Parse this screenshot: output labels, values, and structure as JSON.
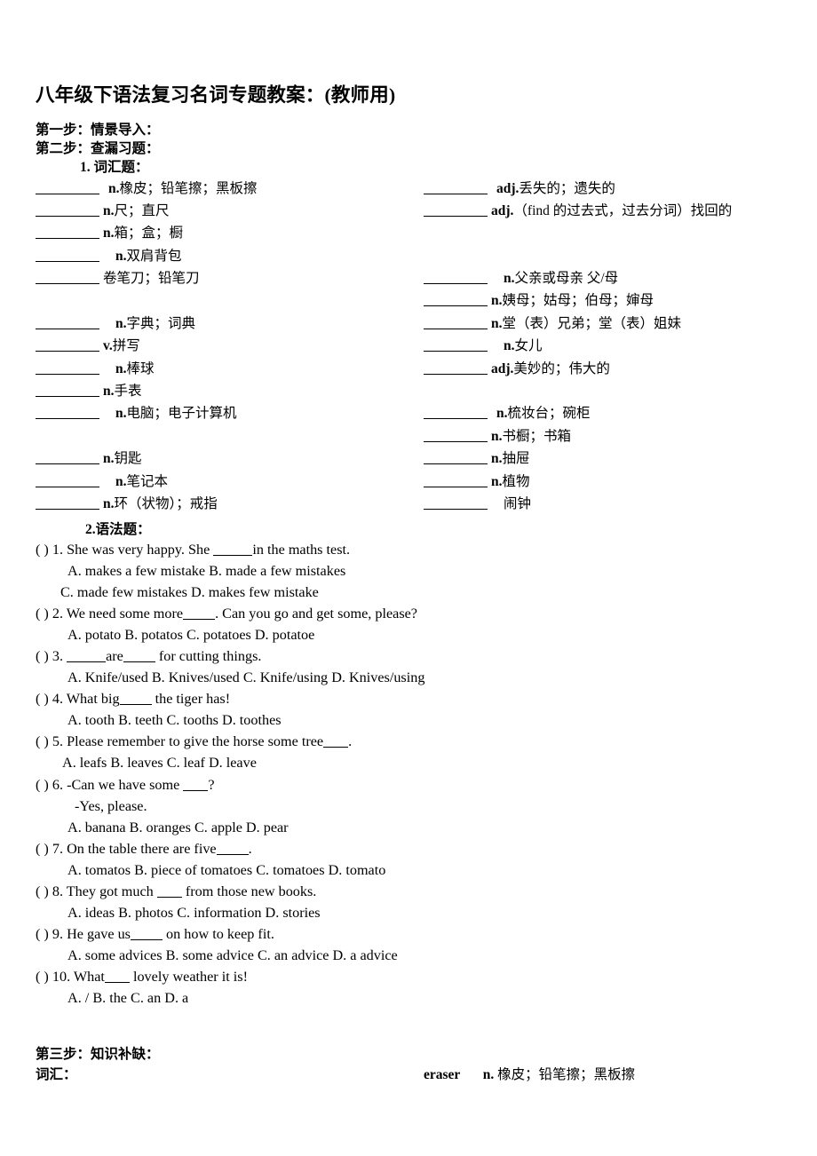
{
  "title": "八年级下语法复习名词专题教案：(教师用)",
  "steps": {
    "step1": "第一步：情景导入：",
    "step2": "第二步：查漏习题：",
    "step3": "第三步：知识补缺："
  },
  "sections": {
    "vocab_head": "1. 词汇题：",
    "grammar_head": "2.语法题：",
    "vocab_label": "词汇："
  },
  "vocab_left": [
    {
      "blank": "bl-7",
      "indent": "gap-m",
      "pos": "n.",
      "meaning": "橡皮；铅笔擦；黑板擦"
    },
    {
      "blank": "bl-7",
      "indent": "",
      "pos": "n.",
      "meaning": "尺；直尺"
    },
    {
      "blank": "bl-7",
      "indent": "",
      "pos": "n.",
      "meaning": "箱；盒；橱"
    },
    {
      "blank": "bl-7",
      "indent": "gap-l",
      "pos": "n.",
      "meaning": "双肩背包"
    },
    {
      "blank": "bl-7",
      "indent": "",
      "pos": "",
      "meaning": "卷笔刀；铅笔刀"
    },
    {
      "spacer": true
    },
    {
      "blank": "bl-7",
      "indent": "gap-l",
      "pos": "n.",
      "meaning": "字典；词典"
    },
    {
      "blank": "bl-7",
      "indent": "",
      "pos": "v.",
      "meaning": "拼写"
    },
    {
      "blank": "bl-7",
      "indent": "gap-l",
      "pos": "n.",
      "meaning": "棒球"
    },
    {
      "blank": "bl-7",
      "indent": "",
      "pos": "n.",
      "meaning": "手表"
    },
    {
      "blank": "bl-7",
      "indent": "gap-l",
      "pos": "n.",
      "meaning": "电脑；电子计算机"
    },
    {
      "spacer": true
    },
    {
      "blank": "bl-7",
      "indent": "",
      "pos": "n.",
      "meaning": "钥匙"
    },
    {
      "blank": "bl-7",
      "indent": "gap-l",
      "pos": "n.",
      "meaning": "笔记本"
    },
    {
      "blank": "bl-7",
      "indent": "",
      "pos": "n.",
      "meaning": "环（状物）；戒指"
    }
  ],
  "vocab_right": [
    {
      "blank": "bl-7",
      "indent": "gap-m",
      "pos": "adj.",
      "meaning": "丢失的；遗失的"
    },
    {
      "blank": "bl-7",
      "indent": "",
      "pos": "adj.",
      "meaning": "（find 的过去式，过去分词）找回的"
    },
    {
      "spacer": true
    },
    {
      "spacer": true
    },
    {
      "blank": "bl-7",
      "indent": "gap-l",
      "pos": "n.",
      "meaning": "父亲或母亲   父/母"
    },
    {
      "blank": "bl-7",
      "indent": "",
      "pos": "n.",
      "meaning": "姨母；姑母；伯母；婶母"
    },
    {
      "blank": "bl-7",
      "indent": "",
      "pos": "n.",
      "meaning": "堂（表）兄弟；堂（表）姐妹"
    },
    {
      "blank": "bl-7",
      "indent": "gap-l",
      "pos": "n.",
      "meaning": "女儿"
    },
    {
      "blank": "bl-7",
      "indent": "",
      "pos": "adj.",
      "meaning": "美妙的；伟大的"
    },
    {
      "spacer": true
    },
    {
      "blank": "bl-7",
      "indent": "gap-m",
      "pos": "n.",
      "meaning": "梳妆台；碗柜"
    },
    {
      "blank": "bl-7",
      "indent": "",
      "pos": "n.",
      "meaning": "书橱；书箱"
    },
    {
      "blank": "bl-7",
      "indent": "",
      "pos": "n.",
      "meaning": "抽屉"
    },
    {
      "blank": "bl-7",
      "indent": "",
      "pos": "n.",
      "meaning": "植物"
    },
    {
      "blank": "bl-7",
      "indent": "gap-l",
      "pos": "",
      "meaning": "闹钟"
    }
  ],
  "questions": [
    {
      "paren": "(    ) ",
      "stem_before": "1. She was very happy. She ",
      "ul": "ul-5",
      "stem_after": "in the maths test.",
      "lines": [
        {
          "indent": "q-opt",
          "text": "A. makes a few mistake B. made a few mistakes"
        },
        {
          "indent": "q-opt-b",
          "text": "C. made few mistakes D. makes few mistake"
        }
      ]
    },
    {
      "paren": "(    ) ",
      "stem_before": "2. We need some more",
      "ul": "ul-4",
      "stem_after": ". Can you go and get some, please?",
      "lines": [
        {
          "indent": "q-opt",
          "text": "A. potato B. potatos    C. potatoes    D. potatoe"
        }
      ]
    },
    {
      "paren": "(    ) ",
      "stem_before": "3. ",
      "ul": "ul-5",
      "stem_mid": "are",
      "ul2": "ul-4",
      "stem_after": " for cutting things.",
      "lines": [
        {
          "indent": "q-opt",
          "text": "A. Knife/used B. Knives/used C. Knife/using D. Knives/using"
        }
      ]
    },
    {
      "paren": "(    ) ",
      "stem_before": "4. What big",
      "ul": "ul-4",
      "stem_after": " the tiger has!",
      "lines": [
        {
          "indent": "q-opt",
          "text": "A. tooth B. teeth C. tooths D. toothes"
        }
      ]
    },
    {
      "paren": "(    ) ",
      "stem_before": "5. Please remember to give the horse some tree",
      "ul": "ul-3",
      "stem_after": ".",
      "lines": [
        {
          "indent": "q-opt-c",
          "text": "A. leafs B. leaves C. leaf D. leave"
        }
      ]
    },
    {
      "paren": "(    ) ",
      "stem_before": "6. -Can we have some ",
      "ul": "ul-3",
      "stem_after": "?",
      "lines": [
        {
          "indent": "q-sub",
          "text": "-Yes, please."
        },
        {
          "indent": "q-opt",
          "text": "A. banana B. oranges C. apple    D. pear"
        }
      ]
    },
    {
      "paren": "(    ) ",
      "stem_before": "7. On the table there are five",
      "ul": "ul-4",
      "stem_after": ".",
      "lines": [
        {
          "indent": "q-opt",
          "text": "A. tomatos    B. piece of tomatoes    C. tomatoes    D. tomato"
        }
      ]
    },
    {
      "paren": "(    ) ",
      "stem_before": "8. They got much ",
      "ul": "ul-3",
      "stem_after": " from those new books.",
      "lines": [
        {
          "indent": "q-opt",
          "text": "A. ideas B. photos C. information D. stories"
        }
      ]
    },
    {
      "paren": "(    ) ",
      "stem_before": "9. He gave us",
      "ul": "ul-4",
      "stem_after": " on how to keep fit.",
      "lines": [
        {
          "indent": "q-opt",
          "text": "A. some advices B. some advice C. an advice D. a advice"
        }
      ]
    },
    {
      "paren": "(    ) ",
      "stem_before": "10. What",
      "ul": "ul-3",
      "stem_after": " lovely weather it is!",
      "lines": [
        {
          "indent": "q-opt",
          "text": "A. /    B. the    C. an    D. a"
        }
      ]
    }
  ],
  "final_entry": {
    "word": "eraser",
    "pos": "n.",
    "meaning": "橡皮；铅笔擦；黑板擦"
  }
}
